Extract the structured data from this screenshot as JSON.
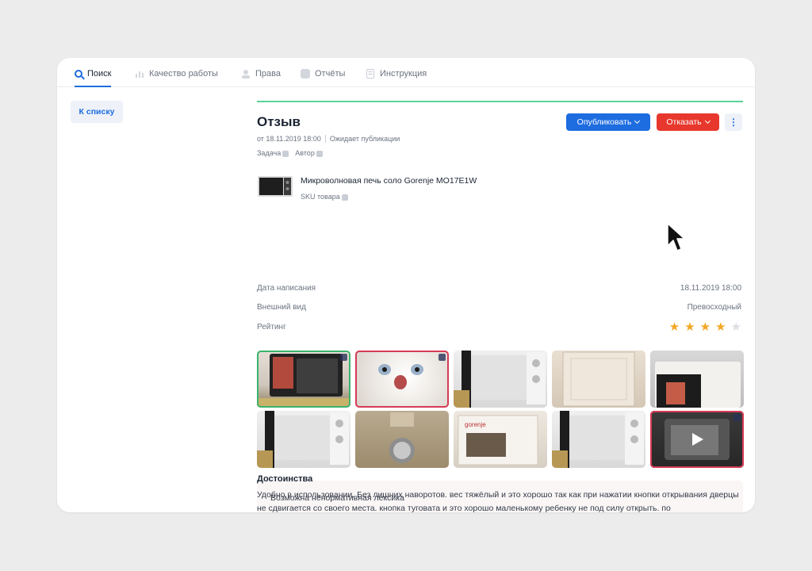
{
  "nav": {
    "items": [
      {
        "label": "Поиск",
        "icon": "search-icon"
      },
      {
        "label": "Качество работы",
        "icon": "bar-chart-icon"
      },
      {
        "label": "Права",
        "icon": "user-icon"
      },
      {
        "label": "Отчёты",
        "icon": "report-icon"
      },
      {
        "label": "Инструкция",
        "icon": "document-icon"
      }
    ]
  },
  "back_label": "К списку",
  "review": {
    "title": "Отзыв",
    "date": "от 18.11.2019 18:00",
    "status": "Ожидает публикации",
    "task_label": "Задача",
    "author_label": "Автор",
    "publish_label": "Опубликовать",
    "reject_label": "Отказать",
    "more_label": "⋮"
  },
  "product": {
    "name": "Микроволновая печь соло Gorenje MO17E1W",
    "sku_label": "SKU товара"
  },
  "details": [
    {
      "label": "Дата написания",
      "value": "18.11.2019 18:00"
    },
    {
      "label": "Внешний вид",
      "value": "Превосходный"
    },
    {
      "label": "Рейтинг",
      "value": ""
    }
  ],
  "rating": 4,
  "rating_max": 5,
  "warning_text": "Возможна ненормативная лексика",
  "pros": {
    "title": "Достоинства",
    "text": "Удобно в использовании. Без лишних наворотов. вес тяжёлый и это хорошо так как при нажатии кнопки открывания дверцы не сдвигается со своего места. кнопка туговата и это хорошо маленькому ребенку не под силу открыть. по"
  },
  "colors": {
    "accent": "#1d6ce0",
    "danger": "#e8382d",
    "success_line": "#5ad19a",
    "star": "#f5a623"
  }
}
